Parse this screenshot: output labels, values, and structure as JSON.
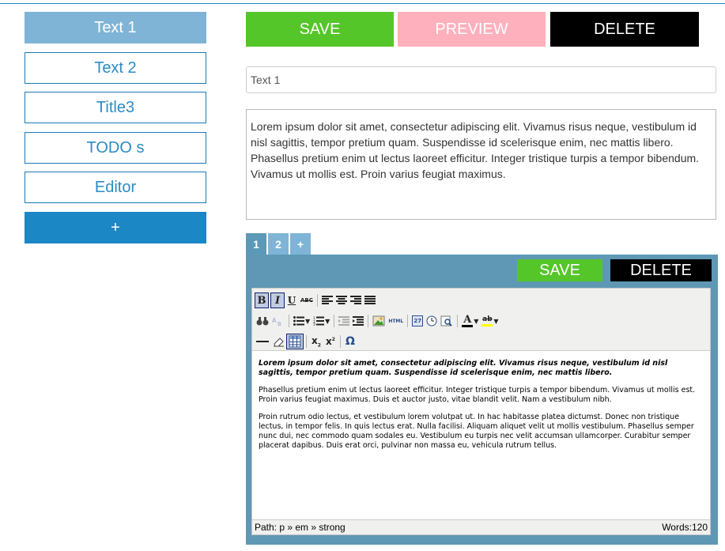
{
  "sidebar": {
    "items": [
      {
        "label": "Text 1"
      },
      {
        "label": "Text 2"
      },
      {
        "label": "Title3"
      },
      {
        "label": "TODO s"
      },
      {
        "label": "Editor"
      }
    ],
    "add_label": "+"
  },
  "toolbar": {
    "save_label": "SAVE",
    "preview_label": "PREVIEW",
    "delete_label": "DELETE"
  },
  "title_field": {
    "value": "Text 1"
  },
  "description": {
    "value": "Lorem ipsum dolor sit amet, consectetur adipiscing elit. Vivamus risus neque, vestibulum id nisl sagittis, tempor pretium quam. Suspendisse id scelerisque enim, nec mattis libero. Phasellus pretium enim ut lectus laoreet efficitur. Integer tristique turpis a tempor bibendum. Vivamus ut mollis est. Proin varius feugiat maximus."
  },
  "tabs": [
    {
      "label": "1"
    },
    {
      "label": "2"
    },
    {
      "label": "+"
    }
  ],
  "panel": {
    "save_label": "SAVE",
    "delete_label": "DELETE"
  },
  "editor": {
    "toolbar_icons": {
      "row1": [
        "bold-icon",
        "italic-icon",
        "underline-icon",
        "strikethrough-icon",
        "align-left-icon",
        "align-center-icon",
        "align-right-icon",
        "align-justify-icon"
      ],
      "row2": [
        "find-icon",
        "replace-icon",
        "bullet-list-icon",
        "numbered-list-icon",
        "outdent-icon",
        "indent-icon",
        "image-icon",
        "html-icon",
        "insert-date-icon",
        "insert-time-icon",
        "preview-icon",
        "text-color-icon",
        "highlight-color-icon"
      ],
      "row3": [
        "horizontal-rule-icon",
        "eraser-icon",
        "table-icon",
        "subscript-icon",
        "superscript-icon",
        "omega-icon"
      ]
    },
    "buttons": {
      "underline": "U",
      "strike": "ABC",
      "html": "HTML",
      "calendar": "27",
      "subscript_base": "x",
      "subscript_mark": "2",
      "superscript_base": "x",
      "superscript_mark": "2",
      "omega": "Ω",
      "text_color": "A",
      "highlight": "ab"
    },
    "paragraphs": [
      "Lorem ipsum dolor sit amet, consectetur adipiscing elit. Vivamus risus neque, vestibulum id nisl sagittis, tempor pretium quam. Suspendisse id scelerisque enim, nec mattis libero.",
      "Phasellus pretium enim ut lectus laoreet efficitur. Integer tristique turpis a tempor bibendum. Vivamus ut mollis est. Proin varius feugiat maximus. Duis et auctor justo, vitae blandit velit. Nam a vestibulum nibh.",
      "Proin rutrum odio lectus, et vestibulum lorem volutpat ut. In hac habitasse platea dictumst. Donec non tristique lectus, in tempor felis. In quis lectus erat. Nulla facilisi. Aliquam aliquet velit ut mollis vestibulum. Phasellus semper nunc dui, nec commodo quam sodales eu. Vestibulum eu turpis nec velit accumsan ullamcorper. Curabitur semper placerat dapibus. Duis erat orci, pulvinar non massa eu, vehicula rutrum tellus."
    ],
    "status_path": "Path: p » em » strong",
    "word_count": "Words:120"
  },
  "colors": {
    "accent_blue": "#1b87c5",
    "sidebar_active": "#7fb4d6",
    "save_green": "#55c629",
    "preview_pink": "#ffb0bd",
    "delete_black": "#000000",
    "panel_blue": "#5e98b4"
  }
}
